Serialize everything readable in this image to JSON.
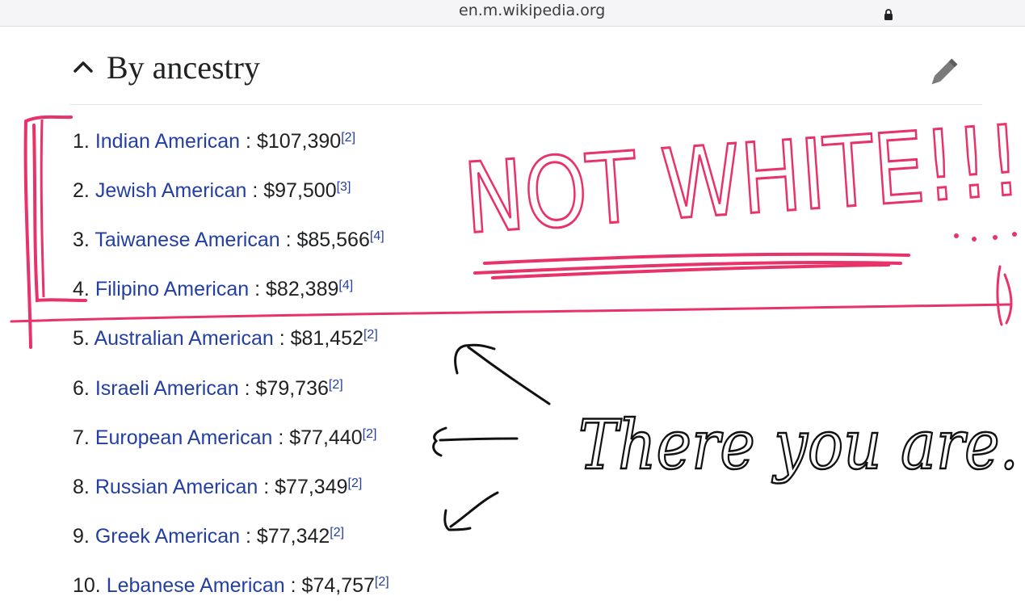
{
  "browser": {
    "host": "en.m.wikipedia.org"
  },
  "section": {
    "title": "By ancestry"
  },
  "ancestry_list": [
    {
      "number": "1.",
      "group": "Indian American",
      "separator": " : ",
      "income": "$107,390",
      "ref": "[2]"
    },
    {
      "number": "2.",
      "group": "Jewish American",
      "separator": " : ",
      "income": "$97,500",
      "ref": "[3]"
    },
    {
      "number": "3.",
      "group": "Taiwanese American",
      "separator": " : ",
      "income": "$85,566",
      "ref": "[4]"
    },
    {
      "number": "4.",
      "group": "Filipino American",
      "separator": " : ",
      "income": "$82,389",
      "ref": "[4]"
    },
    {
      "number": "5.",
      "group": "Australian American",
      "separator": " : ",
      "income": "$81,452",
      "ref": "[2]"
    },
    {
      "number": "6.",
      "group": "Israeli American",
      "separator": " : ",
      "income": "$79,736",
      "ref": "[2]"
    },
    {
      "number": "7.",
      "group": "European American",
      "separator": " : ",
      "income": "$77,440",
      "ref": "[2]"
    },
    {
      "number": "8.",
      "group": "Russian American",
      "separator": " : ",
      "income": "$77,349",
      "ref": "[2]"
    },
    {
      "number": "9.",
      "group": "Greek American",
      "separator": " : ",
      "income": "$77,342",
      "ref": "[2]"
    },
    {
      "number": "10.",
      "group": "Lebanese American",
      "separator": " : ",
      "income": "$74,757",
      "ref": "[2]"
    }
  ],
  "annotations": {
    "not_white_text": "NOT WHITE!!!",
    "there_you_are_text": "There you are.",
    "pink_ink_color": "#e8326a",
    "black_ink_color": "#111111"
  }
}
